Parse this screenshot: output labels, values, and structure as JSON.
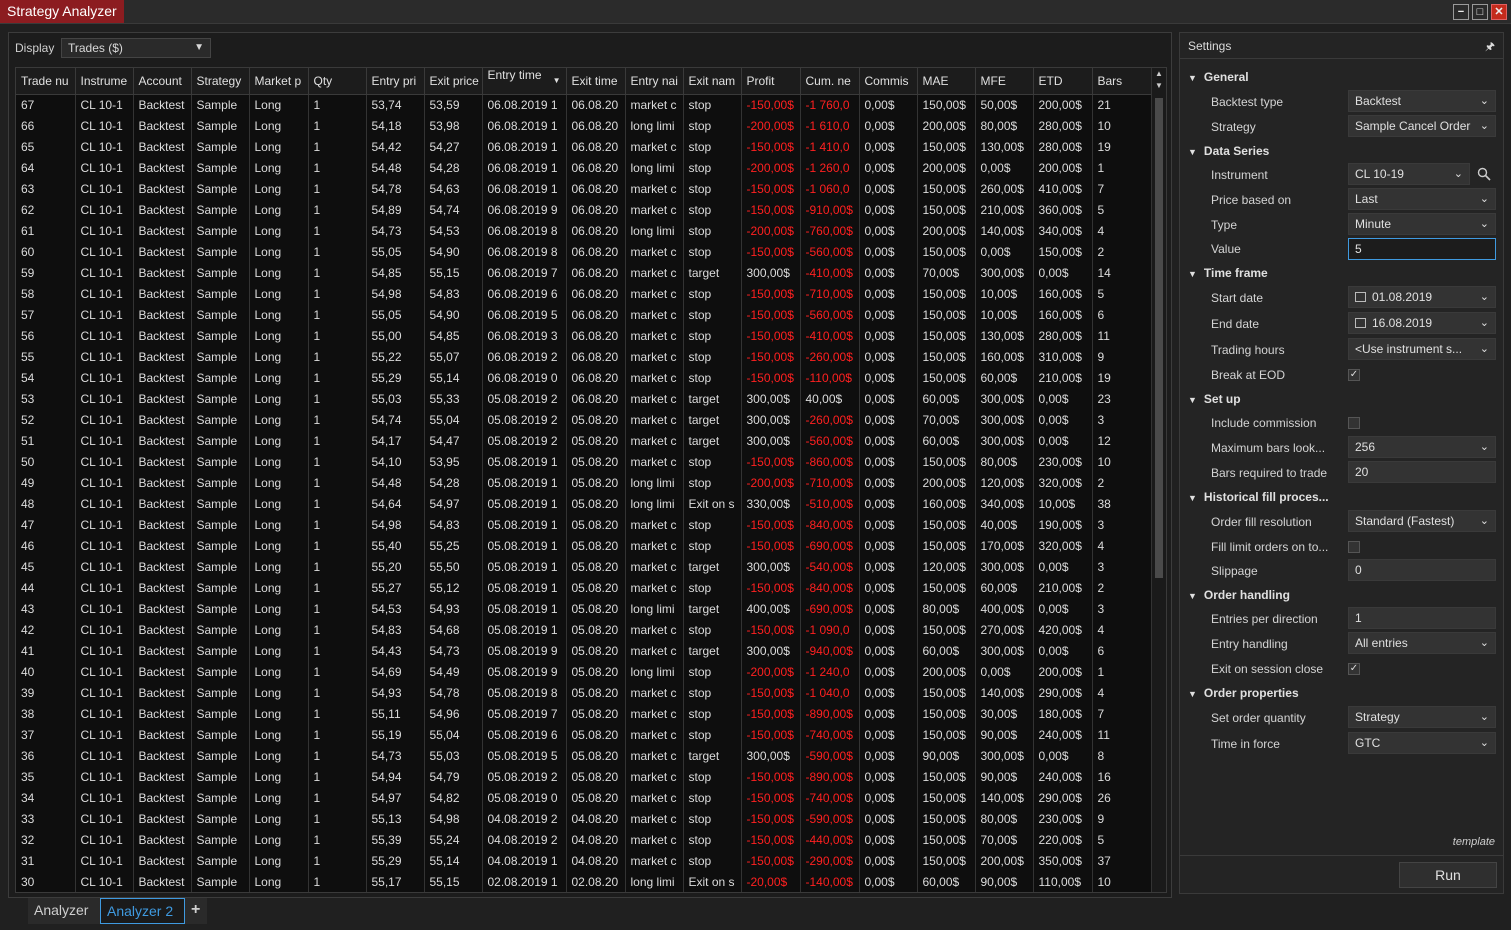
{
  "window": {
    "title": "Strategy Analyzer",
    "min_icon": "minimize-icon",
    "max_icon": "maximize-icon",
    "close_icon": "close-icon"
  },
  "display": {
    "label": "Display",
    "value": "Trades ($)"
  },
  "grid": {
    "columns": [
      "Trade nu",
      "Instrume",
      "Account",
      "Strategy",
      "Market p",
      "Qty",
      "Entry pri",
      "Exit price",
      "Entry time",
      "Exit time",
      "Entry nai",
      "Exit nam",
      "Profit",
      "Cum. ne",
      "Commis",
      "MAE",
      "MFE",
      "ETD",
      "Bars"
    ],
    "rows": [
      [
        "67",
        "CL 10-1",
        "Backtest",
        "Sample",
        "Long",
        "1",
        "53,74",
        "53,59",
        "06.08.2019 1",
        "06.08.20",
        "market c",
        "stop",
        "-150,00$",
        "-1 760,0",
        "0,00$",
        "150,00$",
        "50,00$",
        "200,00$",
        "21"
      ],
      [
        "66",
        "CL 10-1",
        "Backtest",
        "Sample",
        "Long",
        "1",
        "54,18",
        "53,98",
        "06.08.2019 1",
        "06.08.20",
        "long limi",
        "stop",
        "-200,00$",
        "-1 610,0",
        "0,00$",
        "200,00$",
        "80,00$",
        "280,00$",
        "10"
      ],
      [
        "65",
        "CL 10-1",
        "Backtest",
        "Sample",
        "Long",
        "1",
        "54,42",
        "54,27",
        "06.08.2019 1",
        "06.08.20",
        "market c",
        "stop",
        "-150,00$",
        "-1 410,0",
        "0,00$",
        "150,00$",
        "130,00$",
        "280,00$",
        "19"
      ],
      [
        "64",
        "CL 10-1",
        "Backtest",
        "Sample",
        "Long",
        "1",
        "54,48",
        "54,28",
        "06.08.2019 1",
        "06.08.20",
        "long limi",
        "stop",
        "-200,00$",
        "-1 260,0",
        "0,00$",
        "200,00$",
        "0,00$",
        "200,00$",
        "1"
      ],
      [
        "63",
        "CL 10-1",
        "Backtest",
        "Sample",
        "Long",
        "1",
        "54,78",
        "54,63",
        "06.08.2019 1",
        "06.08.20",
        "market c",
        "stop",
        "-150,00$",
        "-1 060,0",
        "0,00$",
        "150,00$",
        "260,00$",
        "410,00$",
        "7"
      ],
      [
        "62",
        "CL 10-1",
        "Backtest",
        "Sample",
        "Long",
        "1",
        "54,89",
        "54,74",
        "06.08.2019 9",
        "06.08.20",
        "market c",
        "stop",
        "-150,00$",
        "-910,00$",
        "0,00$",
        "150,00$",
        "210,00$",
        "360,00$",
        "5"
      ],
      [
        "61",
        "CL 10-1",
        "Backtest",
        "Sample",
        "Long",
        "1",
        "54,73",
        "54,53",
        "06.08.2019 8",
        "06.08.20",
        "long limi",
        "stop",
        "-200,00$",
        "-760,00$",
        "0,00$",
        "200,00$",
        "140,00$",
        "340,00$",
        "4"
      ],
      [
        "60",
        "CL 10-1",
        "Backtest",
        "Sample",
        "Long",
        "1",
        "55,05",
        "54,90",
        "06.08.2019 8",
        "06.08.20",
        "market c",
        "stop",
        "-150,00$",
        "-560,00$",
        "0,00$",
        "150,00$",
        "0,00$",
        "150,00$",
        "2"
      ],
      [
        "59",
        "CL 10-1",
        "Backtest",
        "Sample",
        "Long",
        "1",
        "54,85",
        "55,15",
        "06.08.2019 7",
        "06.08.20",
        "market c",
        "target",
        "300,00$",
        "-410,00$",
        "0,00$",
        "70,00$",
        "300,00$",
        "0,00$",
        "14"
      ],
      [
        "58",
        "CL 10-1",
        "Backtest",
        "Sample",
        "Long",
        "1",
        "54,98",
        "54,83",
        "06.08.2019 6",
        "06.08.20",
        "market c",
        "stop",
        "-150,00$",
        "-710,00$",
        "0,00$",
        "150,00$",
        "10,00$",
        "160,00$",
        "5"
      ],
      [
        "57",
        "CL 10-1",
        "Backtest",
        "Sample",
        "Long",
        "1",
        "55,05",
        "54,90",
        "06.08.2019 5",
        "06.08.20",
        "market c",
        "stop",
        "-150,00$",
        "-560,00$",
        "0,00$",
        "150,00$",
        "10,00$",
        "160,00$",
        "6"
      ],
      [
        "56",
        "CL 10-1",
        "Backtest",
        "Sample",
        "Long",
        "1",
        "55,00",
        "54,85",
        "06.08.2019 3",
        "06.08.20",
        "market c",
        "stop",
        "-150,00$",
        "-410,00$",
        "0,00$",
        "150,00$",
        "130,00$",
        "280,00$",
        "11"
      ],
      [
        "55",
        "CL 10-1",
        "Backtest",
        "Sample",
        "Long",
        "1",
        "55,22",
        "55,07",
        "06.08.2019 2",
        "06.08.20",
        "market c",
        "stop",
        "-150,00$",
        "-260,00$",
        "0,00$",
        "150,00$",
        "160,00$",
        "310,00$",
        "9"
      ],
      [
        "54",
        "CL 10-1",
        "Backtest",
        "Sample",
        "Long",
        "1",
        "55,29",
        "55,14",
        "06.08.2019 0",
        "06.08.20",
        "market c",
        "stop",
        "-150,00$",
        "-110,00$",
        "0,00$",
        "150,00$",
        "60,00$",
        "210,00$",
        "19"
      ],
      [
        "53",
        "CL 10-1",
        "Backtest",
        "Sample",
        "Long",
        "1",
        "55,03",
        "55,33",
        "05.08.2019 2",
        "06.08.20",
        "market c",
        "target",
        "300,00$",
        "40,00$",
        "0,00$",
        "60,00$",
        "300,00$",
        "0,00$",
        "23"
      ],
      [
        "52",
        "CL 10-1",
        "Backtest",
        "Sample",
        "Long",
        "1",
        "54,74",
        "55,04",
        "05.08.2019 2",
        "05.08.20",
        "market c",
        "target",
        "300,00$",
        "-260,00$",
        "0,00$",
        "70,00$",
        "300,00$",
        "0,00$",
        "3"
      ],
      [
        "51",
        "CL 10-1",
        "Backtest",
        "Sample",
        "Long",
        "1",
        "54,17",
        "54,47",
        "05.08.2019 2",
        "05.08.20",
        "market c",
        "target",
        "300,00$",
        "-560,00$",
        "0,00$",
        "60,00$",
        "300,00$",
        "0,00$",
        "12"
      ],
      [
        "50",
        "CL 10-1",
        "Backtest",
        "Sample",
        "Long",
        "1",
        "54,10",
        "53,95",
        "05.08.2019 1",
        "05.08.20",
        "market c",
        "stop",
        "-150,00$",
        "-860,00$",
        "0,00$",
        "150,00$",
        "80,00$",
        "230,00$",
        "10"
      ],
      [
        "49",
        "CL 10-1",
        "Backtest",
        "Sample",
        "Long",
        "1",
        "54,48",
        "54,28",
        "05.08.2019 1",
        "05.08.20",
        "long limi",
        "stop",
        "-200,00$",
        "-710,00$",
        "0,00$",
        "200,00$",
        "120,00$",
        "320,00$",
        "2"
      ],
      [
        "48",
        "CL 10-1",
        "Backtest",
        "Sample",
        "Long",
        "1",
        "54,64",
        "54,97",
        "05.08.2019 1",
        "05.08.20",
        "long limi",
        "Exit on s",
        "330,00$",
        "-510,00$",
        "0,00$",
        "160,00$",
        "340,00$",
        "10,00$",
        "38"
      ],
      [
        "47",
        "CL 10-1",
        "Backtest",
        "Sample",
        "Long",
        "1",
        "54,98",
        "54,83",
        "05.08.2019 1",
        "05.08.20",
        "market c",
        "stop",
        "-150,00$",
        "-840,00$",
        "0,00$",
        "150,00$",
        "40,00$",
        "190,00$",
        "3"
      ],
      [
        "46",
        "CL 10-1",
        "Backtest",
        "Sample",
        "Long",
        "1",
        "55,40",
        "55,25",
        "05.08.2019 1",
        "05.08.20",
        "market c",
        "stop",
        "-150,00$",
        "-690,00$",
        "0,00$",
        "150,00$",
        "170,00$",
        "320,00$",
        "4"
      ],
      [
        "45",
        "CL 10-1",
        "Backtest",
        "Sample",
        "Long",
        "1",
        "55,20",
        "55,50",
        "05.08.2019 1",
        "05.08.20",
        "market c",
        "target",
        "300,00$",
        "-540,00$",
        "0,00$",
        "120,00$",
        "300,00$",
        "0,00$",
        "3"
      ],
      [
        "44",
        "CL 10-1",
        "Backtest",
        "Sample",
        "Long",
        "1",
        "55,27",
        "55,12",
        "05.08.2019 1",
        "05.08.20",
        "market c",
        "stop",
        "-150,00$",
        "-840,00$",
        "0,00$",
        "150,00$",
        "60,00$",
        "210,00$",
        "2"
      ],
      [
        "43",
        "CL 10-1",
        "Backtest",
        "Sample",
        "Long",
        "1",
        "54,53",
        "54,93",
        "05.08.2019 1",
        "05.08.20",
        "long limi",
        "target",
        "400,00$",
        "-690,00$",
        "0,00$",
        "80,00$",
        "400,00$",
        "0,00$",
        "3"
      ],
      [
        "42",
        "CL 10-1",
        "Backtest",
        "Sample",
        "Long",
        "1",
        "54,83",
        "54,68",
        "05.08.2019 1",
        "05.08.20",
        "market c",
        "stop",
        "-150,00$",
        "-1 090,0",
        "0,00$",
        "150,00$",
        "270,00$",
        "420,00$",
        "4"
      ],
      [
        "41",
        "CL 10-1",
        "Backtest",
        "Sample",
        "Long",
        "1",
        "54,43",
        "54,73",
        "05.08.2019 9",
        "05.08.20",
        "market c",
        "target",
        "300,00$",
        "-940,00$",
        "0,00$",
        "60,00$",
        "300,00$",
        "0,00$",
        "6"
      ],
      [
        "40",
        "CL 10-1",
        "Backtest",
        "Sample",
        "Long",
        "1",
        "54,69",
        "54,49",
        "05.08.2019 9",
        "05.08.20",
        "long limi",
        "stop",
        "-200,00$",
        "-1 240,0",
        "0,00$",
        "200,00$",
        "0,00$",
        "200,00$",
        "1"
      ],
      [
        "39",
        "CL 10-1",
        "Backtest",
        "Sample",
        "Long",
        "1",
        "54,93",
        "54,78",
        "05.08.2019 8",
        "05.08.20",
        "market c",
        "stop",
        "-150,00$",
        "-1 040,0",
        "0,00$",
        "150,00$",
        "140,00$",
        "290,00$",
        "4"
      ],
      [
        "38",
        "CL 10-1",
        "Backtest",
        "Sample",
        "Long",
        "1",
        "55,11",
        "54,96",
        "05.08.2019 7",
        "05.08.20",
        "market c",
        "stop",
        "-150,00$",
        "-890,00$",
        "0,00$",
        "150,00$",
        "30,00$",
        "180,00$",
        "7"
      ],
      [
        "37",
        "CL 10-1",
        "Backtest",
        "Sample",
        "Long",
        "1",
        "55,19",
        "55,04",
        "05.08.2019 6",
        "05.08.20",
        "market c",
        "stop",
        "-150,00$",
        "-740,00$",
        "0,00$",
        "150,00$",
        "90,00$",
        "240,00$",
        "11"
      ],
      [
        "36",
        "CL 10-1",
        "Backtest",
        "Sample",
        "Long",
        "1",
        "54,73",
        "55,03",
        "05.08.2019 5",
        "05.08.20",
        "market c",
        "target",
        "300,00$",
        "-590,00$",
        "0,00$",
        "90,00$",
        "300,00$",
        "0,00$",
        "8"
      ],
      [
        "35",
        "CL 10-1",
        "Backtest",
        "Sample",
        "Long",
        "1",
        "54,94",
        "54,79",
        "05.08.2019 2",
        "05.08.20",
        "market c",
        "stop",
        "-150,00$",
        "-890,00$",
        "0,00$",
        "150,00$",
        "90,00$",
        "240,00$",
        "16"
      ],
      [
        "34",
        "CL 10-1",
        "Backtest",
        "Sample",
        "Long",
        "1",
        "54,97",
        "54,82",
        "05.08.2019 0",
        "05.08.20",
        "market c",
        "stop",
        "-150,00$",
        "-740,00$",
        "0,00$",
        "150,00$",
        "140,00$",
        "290,00$",
        "26"
      ],
      [
        "33",
        "CL 10-1",
        "Backtest",
        "Sample",
        "Long",
        "1",
        "55,13",
        "54,98",
        "04.08.2019 2",
        "04.08.20",
        "market c",
        "stop",
        "-150,00$",
        "-590,00$",
        "0,00$",
        "150,00$",
        "80,00$",
        "230,00$",
        "9"
      ],
      [
        "32",
        "CL 10-1",
        "Backtest",
        "Sample",
        "Long",
        "1",
        "55,39",
        "55,24",
        "04.08.2019 2",
        "04.08.20",
        "market c",
        "stop",
        "-150,00$",
        "-440,00$",
        "0,00$",
        "150,00$",
        "70,00$",
        "220,00$",
        "5"
      ],
      [
        "31",
        "CL 10-1",
        "Backtest",
        "Sample",
        "Long",
        "1",
        "55,29",
        "55,14",
        "04.08.2019 1",
        "04.08.20",
        "market c",
        "stop",
        "-150,00$",
        "-290,00$",
        "0,00$",
        "150,00$",
        "200,00$",
        "350,00$",
        "37"
      ],
      [
        "30",
        "CL 10-1",
        "Backtest",
        "Sample",
        "Long",
        "1",
        "55,17",
        "55,15",
        "02.08.2019 1",
        "02.08.20",
        "long limi",
        "Exit on s",
        "-20,00$",
        "-140,00$",
        "0,00$",
        "60,00$",
        "90,00$",
        "110,00$",
        "10"
      ]
    ]
  },
  "tabs": [
    "Analyzer",
    "Analyzer 2",
    "+"
  ],
  "settings": {
    "title": "Settings",
    "sections": {
      "general": "General",
      "data_series": "Data Series",
      "time_frame": "Time frame",
      "set_up": "Set up",
      "historical": "Historical fill proces...",
      "order_handling": "Order handling",
      "order_properties": "Order properties"
    },
    "labels": {
      "backtest_type": "Backtest type",
      "strategy": "Strategy",
      "instrument": "Instrument",
      "price_based_on": "Price based on",
      "type": "Type",
      "value": "Value",
      "start_date": "Start date",
      "end_date": "End date",
      "trading_hours": "Trading hours",
      "break_eod": "Break at EOD",
      "include_commission": "Include commission",
      "max_bars": "Maximum bars look...",
      "bars_required": "Bars required to trade",
      "order_fill": "Order fill resolution",
      "fill_limit": "Fill limit orders on to...",
      "slippage": "Slippage",
      "entries_per_direction": "Entries per direction",
      "entry_handling": "Entry handling",
      "exit_session_close": "Exit on session close",
      "set_order_qty": "Set order quantity",
      "time_in_force": "Time in force"
    },
    "values": {
      "backtest_type": "Backtest",
      "strategy": "Sample Cancel Order",
      "instrument": "CL 10-19",
      "price_based_on": "Last",
      "type": "Minute",
      "value": "5",
      "start_date": "01.08.2019",
      "end_date": "16.08.2019",
      "trading_hours": "<Use instrument s...",
      "break_eod": true,
      "include_commission": false,
      "max_bars": "256",
      "bars_required": "20",
      "order_fill": "Standard (Fastest)",
      "fill_limit": false,
      "slippage": "0",
      "entries_per_direction": "1",
      "entry_handling": "All entries",
      "exit_session_close": true,
      "set_order_qty": "Strategy",
      "time_in_force": "GTC"
    },
    "template_label": "template",
    "run_label": "Run"
  },
  "colors": {
    "title_bg": "#8c1c20",
    "negative": "#ff2020",
    "accent": "#3f9ae0"
  }
}
